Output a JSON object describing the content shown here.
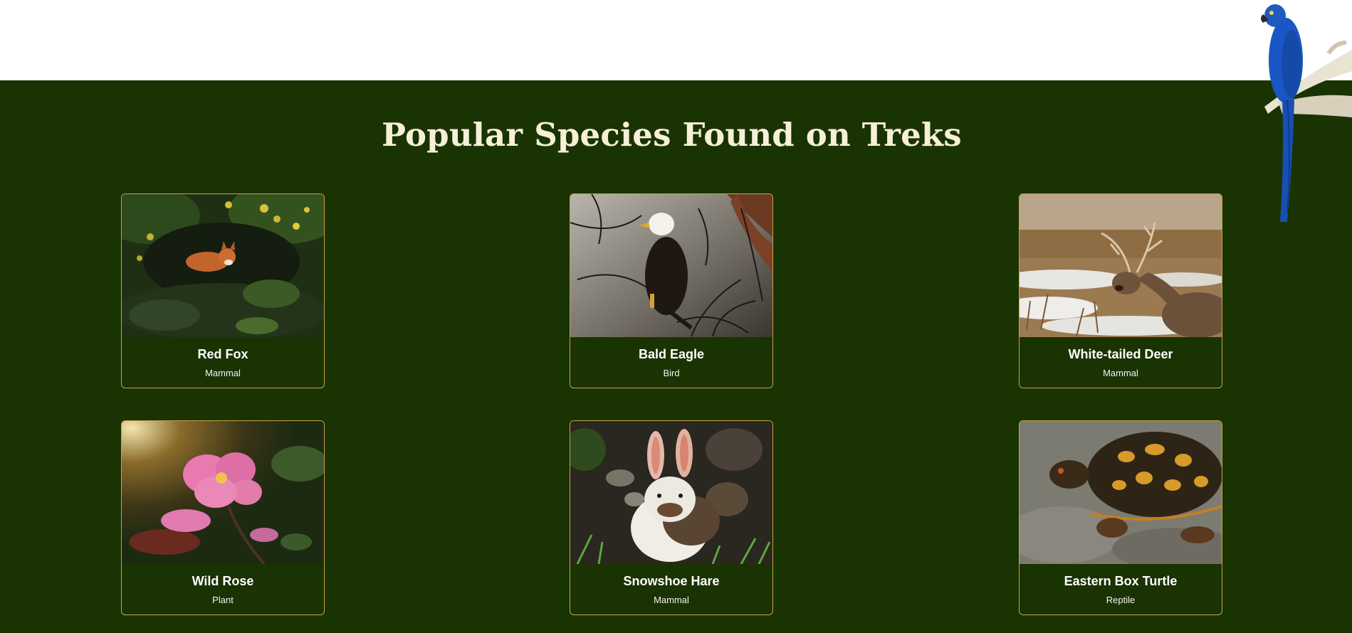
{
  "section": {
    "title": "Popular Species Found on Treks"
  },
  "species": [
    {
      "name": "Red Fox",
      "type": "Mammal",
      "photo_icon": "red-fox-photo"
    },
    {
      "name": "Bald Eagle",
      "type": "Bird",
      "photo_icon": "bald-eagle-photo"
    },
    {
      "name": "White-tailed Deer",
      "type": "Mammal",
      "photo_icon": "white-tailed-deer-photo"
    },
    {
      "name": "Wild Rose",
      "type": "Plant",
      "photo_icon": "wild-rose-photo"
    },
    {
      "name": "Snowshoe Hare",
      "type": "Mammal",
      "photo_icon": "snowshoe-hare-photo"
    },
    {
      "name": "Eastern Box Turtle",
      "type": "Reptile",
      "photo_icon": "eastern-box-turtle-photo"
    }
  ],
  "colors": {
    "section_bg": "#1a3302",
    "card_border": "#c9a24a",
    "title_text": "#f6f0d8"
  },
  "decoration": {
    "icon": "blue-parrot-illustration"
  }
}
